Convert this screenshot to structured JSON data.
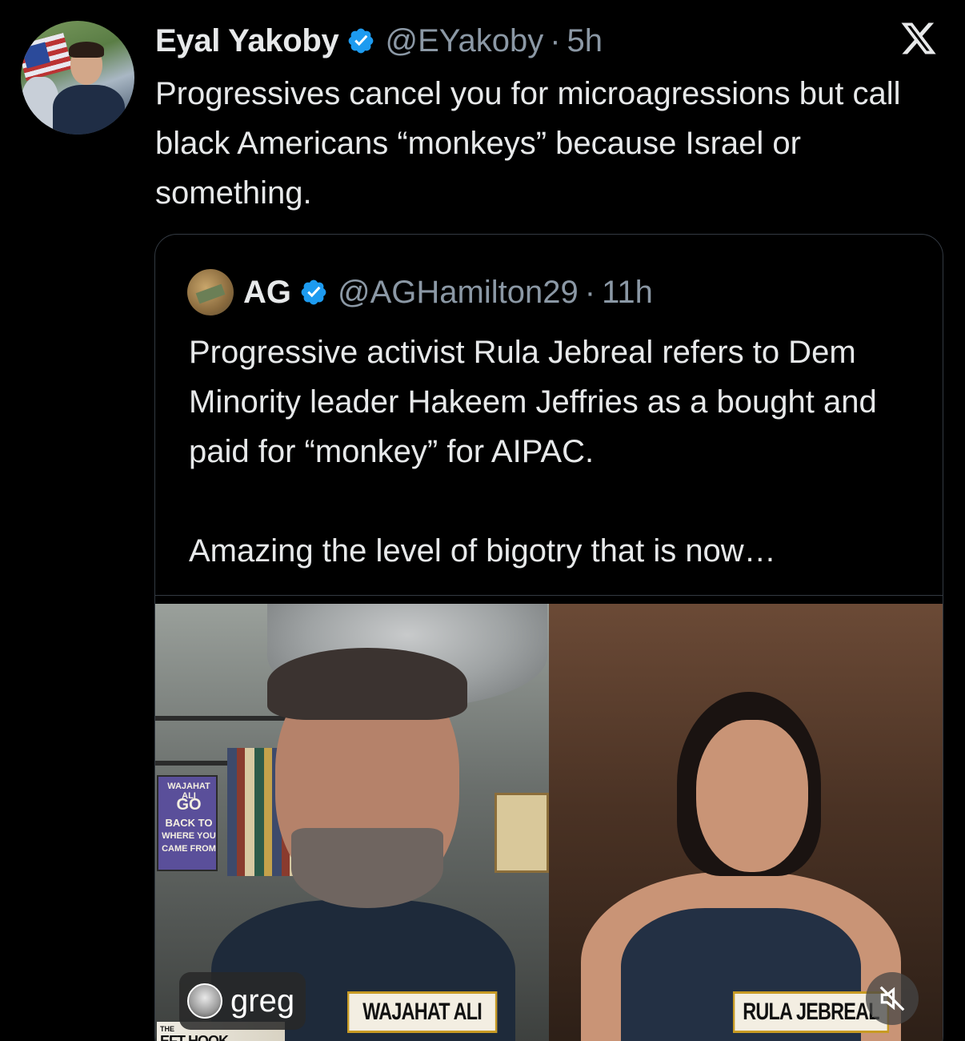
{
  "author": {
    "name": "Eyal Yakoby",
    "handle": "@EYakoby",
    "separator": "·",
    "time": "5h",
    "text": "Progressives cancel you for microagressions but call black Americans “monkeys” because Israel or something."
  },
  "quoted": {
    "name": "AG",
    "handle": "@AGHamilton29",
    "separator": "·",
    "time": "11h",
    "text_p1": "Progressive activist Rula Jebreal refers to Dem Minority leader Hakeem Jeffries as a bought and paid for “monkey” for AIPAC.",
    "text_p2": "Amazing the level of bigotry that is now…"
  },
  "media": {
    "left_name_tag": "WAJAHAT ALI",
    "right_name_tag": "RULA JEBREAL",
    "logo_small": "THE",
    "logo_big": "EFT HOOK",
    "book_cover_lines": [
      "WAJAHAT ALI",
      "GO",
      "BACK TO",
      "WHERE YOU",
      "CAME FROM"
    ],
    "overlay_user": "greg"
  },
  "colors": {
    "background": "#000000",
    "verified": "#1d9bf0",
    "secondary_text": "#8b98a5",
    "border": "#333a42"
  },
  "icons": {
    "verified": "verified-badge-icon",
    "brand": "x-logo-icon",
    "mute": "mute-icon"
  }
}
